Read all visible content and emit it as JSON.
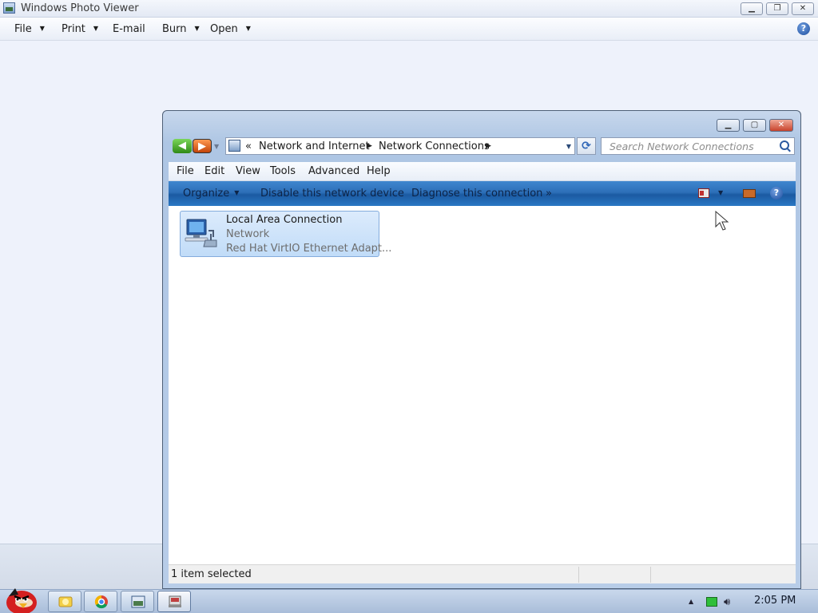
{
  "photo_viewer": {
    "title": "Windows Photo Viewer",
    "menu": [
      {
        "label": "File",
        "has_dropdown": true
      },
      {
        "label": "Print",
        "has_dropdown": true
      },
      {
        "label": "E-mail",
        "has_dropdown": false
      },
      {
        "label": "Burn",
        "has_dropdown": true
      },
      {
        "label": "Open",
        "has_dropdown": true
      }
    ],
    "help_icon": "help-icon"
  },
  "network_window": {
    "address": {
      "overflow": "«",
      "crumbs": [
        "Network and Internet",
        "Network Connections"
      ]
    },
    "search_placeholder": "Search Network Connections",
    "menu": [
      "File",
      "Edit",
      "View",
      "Tools",
      "Advanced",
      "Help"
    ],
    "commands": {
      "organize": "Organize",
      "disable": "Disable this network device",
      "diagnose": "Diagnose this connection",
      "more": "»"
    },
    "items": [
      {
        "name": "Local Area Connection",
        "status": "Network",
        "device": "Red Hat VirtIO Ethernet Adapt...",
        "selected": true
      }
    ],
    "status_text": "1 item selected"
  },
  "taskbar": {
    "buttons": [
      "start-orb",
      "explorer",
      "chrome",
      "photo-viewer",
      "network-connections"
    ],
    "clock": "2:05 PM"
  }
}
